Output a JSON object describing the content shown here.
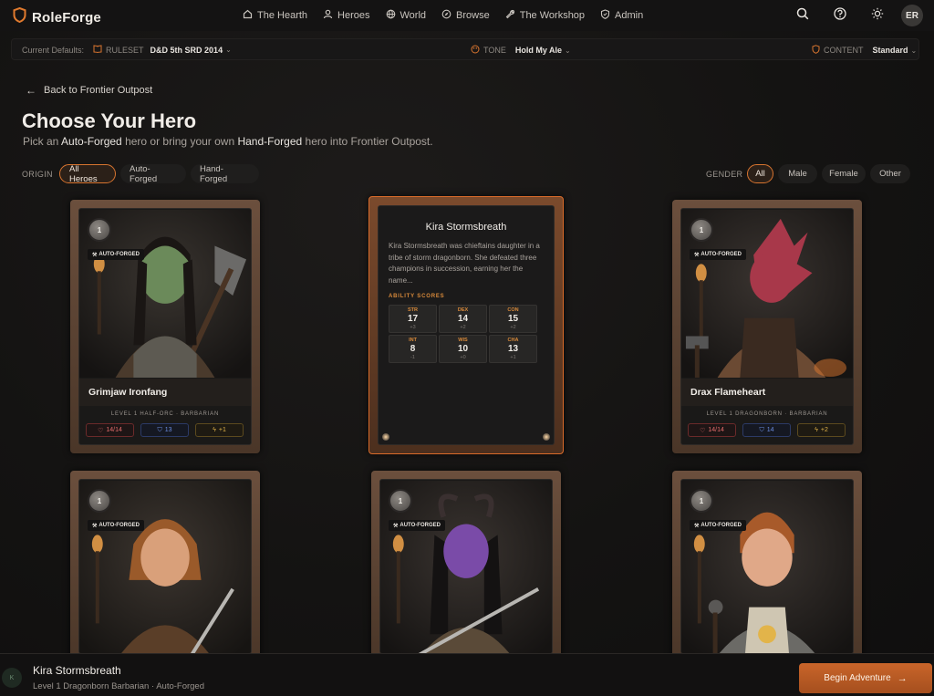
{
  "app": {
    "name": "RoleForge"
  },
  "nav": {
    "items": [
      {
        "label": "The Hearth",
        "icon": "home-icon"
      },
      {
        "label": "Heroes",
        "icon": "user-icon"
      },
      {
        "label": "World",
        "icon": "globe-icon"
      },
      {
        "label": "Browse",
        "icon": "compass-icon"
      },
      {
        "label": "The Workshop",
        "icon": "wrench-icon"
      },
      {
        "label": "Admin",
        "icon": "shield-icon"
      }
    ],
    "avatar_initials": "ER"
  },
  "defaults": {
    "label": "Current Defaults:",
    "ruleset_label": "RULESET",
    "ruleset_value": "D&D 5th SRD 2014",
    "tone_label": "TONE",
    "tone_value": "Hold My Ale",
    "content_label": "CONTENT",
    "content_value": "Standard"
  },
  "header": {
    "back_label": "Back to Frontier Outpost",
    "title": "Choose Your Hero",
    "subtitle_pre": "Pick an ",
    "subtitle_auto": "Auto-Forged",
    "subtitle_mid": " hero or bring your own ",
    "subtitle_hand": "Hand-Forged",
    "subtitle_post": " hero into Frontier Outpost."
  },
  "filters": {
    "origin_label": "ORIGIN",
    "origin_options": [
      "All Heroes",
      "Auto-Forged",
      "Hand-Forged"
    ],
    "origin_selected": "All Heroes",
    "gender_label": "GENDER",
    "gender_options": [
      "All",
      "Male",
      "Female",
      "Other"
    ],
    "gender_selected": "All"
  },
  "cards": [
    {
      "name": "Grimjaw Ironfang",
      "level": "1",
      "badge": "AUTO-FORGED",
      "class_line": "LEVEL 1 HALF-ORC · BARBARIAN",
      "hp": "14/14",
      "ac": "13",
      "init": "+1",
      "skin": "#6b8a5a"
    },
    {
      "name": "Kira Stormsbreath",
      "flipped": true,
      "description": "Kira Stormsbreath was chieftains daughter in a tribe of storm dragonborn. She defeated three champions in succession, earning her the name...",
      "ability_title": "ABILITY SCORES",
      "abilities": [
        {
          "k": "STR",
          "v": "17",
          "m": "+3"
        },
        {
          "k": "DEX",
          "v": "14",
          "m": "+2"
        },
        {
          "k": "CON",
          "v": "15",
          "m": "+2"
        },
        {
          "k": "INT",
          "v": "8",
          "m": "-1"
        },
        {
          "k": "WIS",
          "v": "10",
          "m": "+0"
        },
        {
          "k": "CHA",
          "v": "13",
          "m": "+1"
        }
      ]
    },
    {
      "name": "Drax Flameheart",
      "level": "1",
      "badge": "AUTO-FORGED",
      "class_line": "LEVEL 1 DRAGONBORN · BARBARIAN",
      "hp": "14/14",
      "ac": "14",
      "init": "+2",
      "skin": "#a8384a"
    },
    {
      "level": "1",
      "badge": "AUTO-FORGED",
      "skin": "#d9a07a"
    },
    {
      "level": "1",
      "badge": "AUTO-FORGED",
      "skin": "#7a4ba8"
    },
    {
      "level": "1",
      "badge": "AUTO-FORGED",
      "skin": "#e0a888"
    }
  ],
  "selection": {
    "avatar_letter": "K",
    "name": "Kira Stormsbreath",
    "subtitle": "Level 1 Dragonborn Barbarian · Auto-Forged",
    "button_label": "Begin Adventure"
  },
  "colors": {
    "accent": "#d7742f",
    "brand_shield": "#e07a2e"
  }
}
